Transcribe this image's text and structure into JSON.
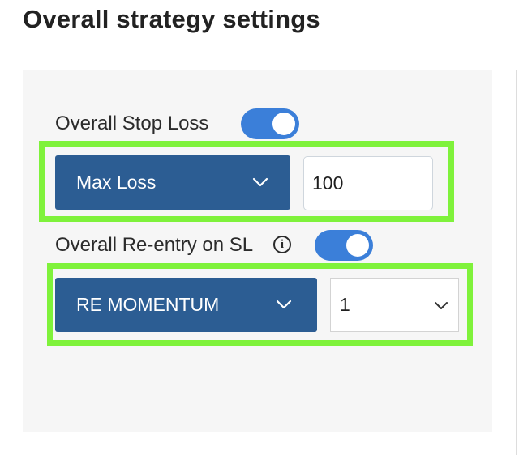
{
  "section": {
    "title": "Overall strategy settings"
  },
  "stop_loss": {
    "label": "Overall Stop Loss",
    "toggle_on": true,
    "type_dropdown": {
      "selected": "Max Loss",
      "icon": "chevron-down-icon"
    },
    "amount_input": {
      "value": "100"
    }
  },
  "reentry": {
    "label": "Overall Re-entry on SL",
    "info_icon": "info-icon",
    "info_glyph": "i",
    "toggle_on": true,
    "type_dropdown": {
      "selected": "RE MOMENTUM",
      "icon": "chevron-down-icon"
    },
    "count_select": {
      "selected": "1",
      "icon": "chevron-down-icon"
    }
  },
  "colors": {
    "toggle_on": "#3b7fd9",
    "dropdown_bg": "#2c5d93",
    "highlight_outline": "#7ff23b",
    "panel_bg": "#f6f6f6"
  }
}
